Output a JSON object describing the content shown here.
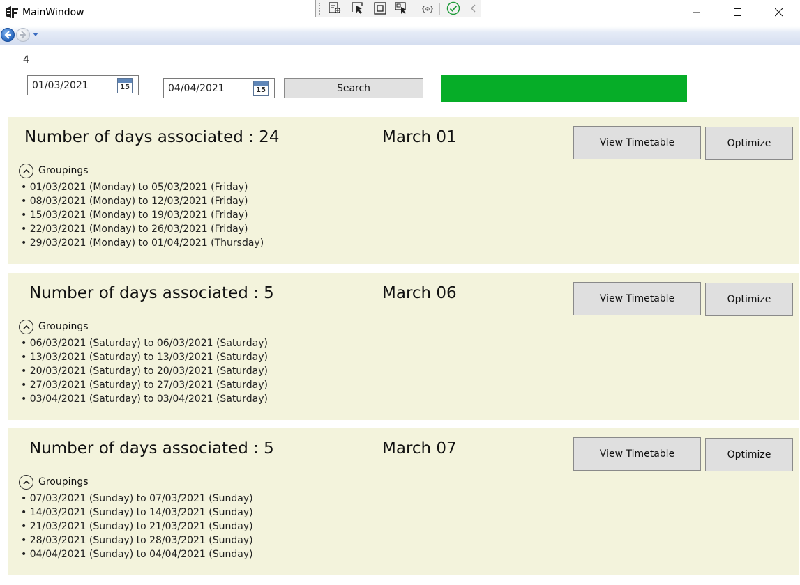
{
  "window": {
    "title": "MainWindow"
  },
  "toolbar": {
    "icons": [
      "select-element-icon",
      "pointer-icon",
      "layout-adorner-icon",
      "track-focus-icon",
      "binding-icon",
      "check-icon",
      "collapse-icon"
    ],
    "window_controls": [
      "minimize-icon",
      "maximize-icon",
      "close-icon"
    ]
  },
  "filters": {
    "count": "4",
    "start_date": "01/03/2021",
    "end_date": "04/04/2021",
    "calendar_day": "15",
    "search_label": "Search",
    "status_color": "#06ad28"
  },
  "cards": [
    {
      "days": "Number of days associated : 24",
      "date_title": "March 01",
      "view_label": "View Timetable",
      "optimize_label": "Optimize",
      "groupings_label": "Groupings",
      "groups": [
        "01/03/2021 (Monday) to 05/03/2021 (Friday)",
        "08/03/2021 (Monday) to 12/03/2021 (Friday)",
        "15/03/2021 (Monday) to 19/03/2021 (Friday)",
        "22/03/2021 (Monday) to 26/03/2021 (Friday)",
        "29/03/2021 (Monday) to 01/04/2021 (Thursday)"
      ]
    },
    {
      "days": "Number of days associated : 5",
      "date_title": "March 06",
      "view_label": "View Timetable",
      "optimize_label": "Optimize",
      "groupings_label": "Groupings",
      "groups": [
        "06/03/2021 (Saturday) to 06/03/2021 (Saturday)",
        "13/03/2021 (Saturday) to 13/03/2021 (Saturday)",
        "20/03/2021 (Saturday) to 20/03/2021 (Saturday)",
        "27/03/2021 (Saturday) to 27/03/2021 (Saturday)",
        "03/04/2021 (Saturday) to 03/04/2021 (Saturday)"
      ]
    },
    {
      "days": "Number of days associated : 5",
      "date_title": "March 07",
      "view_label": "View Timetable",
      "optimize_label": "Optimize",
      "groupings_label": "Groupings",
      "groups": [
        "07/03/2021 (Sunday) to 07/03/2021 (Sunday)",
        "14/03/2021 (Sunday) to 14/03/2021 (Sunday)",
        "21/03/2021 (Sunday) to 21/03/2021 (Sunday)",
        "28/03/2021 (Sunday) to 28/03/2021 (Sunday)",
        "04/04/2021 (Sunday) to 04/04/2021 (Sunday)"
      ]
    }
  ]
}
